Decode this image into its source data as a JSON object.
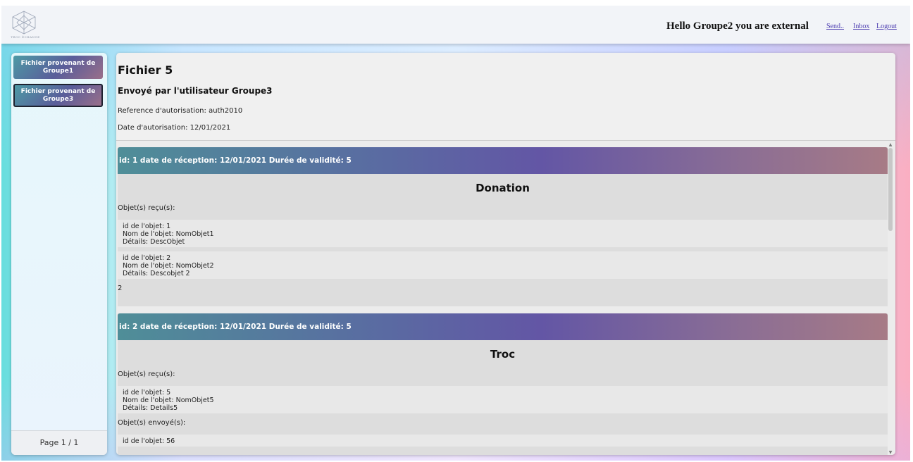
{
  "header": {
    "logo_text": "TROC ÉCHANGE",
    "greeting": "Hello Groupe2 you are external",
    "nav": [
      "Send..",
      "Inbox",
      "Logout"
    ]
  },
  "sidebar": {
    "items": [
      "Fichier provenant de Groupe1",
      "Fichier provenant de Groupe3"
    ],
    "active_index": 1,
    "pager": "Page 1 / 1"
  },
  "file": {
    "title": "Fichier 5",
    "sender": "Envoyé par l'utilisateur Groupe3",
    "reference": "Reference d'autorisation: auth2010",
    "date": "Date d'autorisation: 12/01/2021"
  },
  "cards": [
    {
      "header": "id: 1 date de réception: 12/01/2021 Durée de validité: 5",
      "type": "Donation",
      "received_label": "Objet(s) reçu(s):",
      "received": [
        [
          "id de l'objet: 1",
          "Nom de l'objet: NomObjet1",
          "Détails: DescObjet"
        ],
        [
          "id de l'objet: 2",
          "Nom de l'objet: NomObjet2",
          "Détails: Descobjet 2"
        ]
      ],
      "count": "2"
    },
    {
      "header": "id: 2 date de réception: 12/01/2021 Durée de validité: 5",
      "type": "Troc",
      "received_label": "Objet(s) reçu(s):",
      "received": [
        [
          "id de l'objet: 5",
          "Nom de l'objet: NomObjet5",
          "Détails: Details5"
        ]
      ],
      "sent_label": "Objet(s) envoyé(s):",
      "sent": [
        [
          "id de l'objet: 56"
        ]
      ]
    }
  ],
  "colors": {
    "accent_start": "#4f8e98",
    "accent_mid": "#6356a5",
    "accent_end": "#a77b86"
  }
}
